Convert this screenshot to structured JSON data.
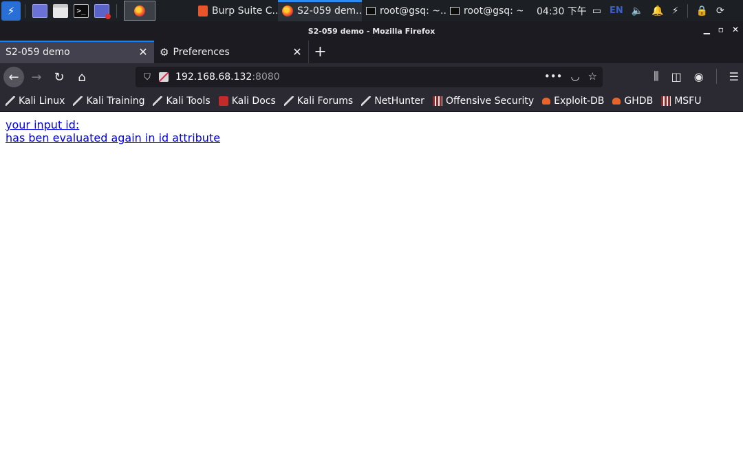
{
  "panel": {
    "launchers": [
      "workspace-launcher",
      "file-manager",
      "terminal",
      "screen-recorder"
    ],
    "tasks": [
      {
        "label": "Burp Suite C...",
        "icon": "burp-icon",
        "active": false
      },
      {
        "label": "S2-059 dem...",
        "icon": "firefox-icon",
        "active": true
      },
      {
        "label": "root@gsq: ~...",
        "icon": "terminal-icon",
        "active": false
      },
      {
        "label": "root@gsq: ~",
        "icon": "terminal-icon",
        "active": false
      }
    ],
    "clock": "04:30 下午",
    "lang": "EN"
  },
  "window": {
    "title": "S2-059 demo - Mozilla Firefox"
  },
  "tabs": [
    {
      "label": "S2-059 demo",
      "selected": true
    },
    {
      "label": "Preferences",
      "selected": false
    }
  ],
  "urlbar": {
    "host": "192.168.68.132",
    "port": ":8080"
  },
  "bookmarks": [
    {
      "label": "Kali Linux"
    },
    {
      "label": "Kali Training"
    },
    {
      "label": "Kali Tools"
    },
    {
      "label": "Kali Docs"
    },
    {
      "label": "Kali Forums"
    },
    {
      "label": "NetHunter"
    },
    {
      "label": "Offensive Security"
    },
    {
      "label": "Exploit-DB"
    },
    {
      "label": "GHDB"
    },
    {
      "label": "MSFU"
    }
  ],
  "page": {
    "line1": "your input id:",
    "line2": "has ben evaluated again in id attribute"
  },
  "colors": {
    "panel_bg": "#1c1f24",
    "accent": "#0a84ff",
    "link": "#0000ee"
  }
}
